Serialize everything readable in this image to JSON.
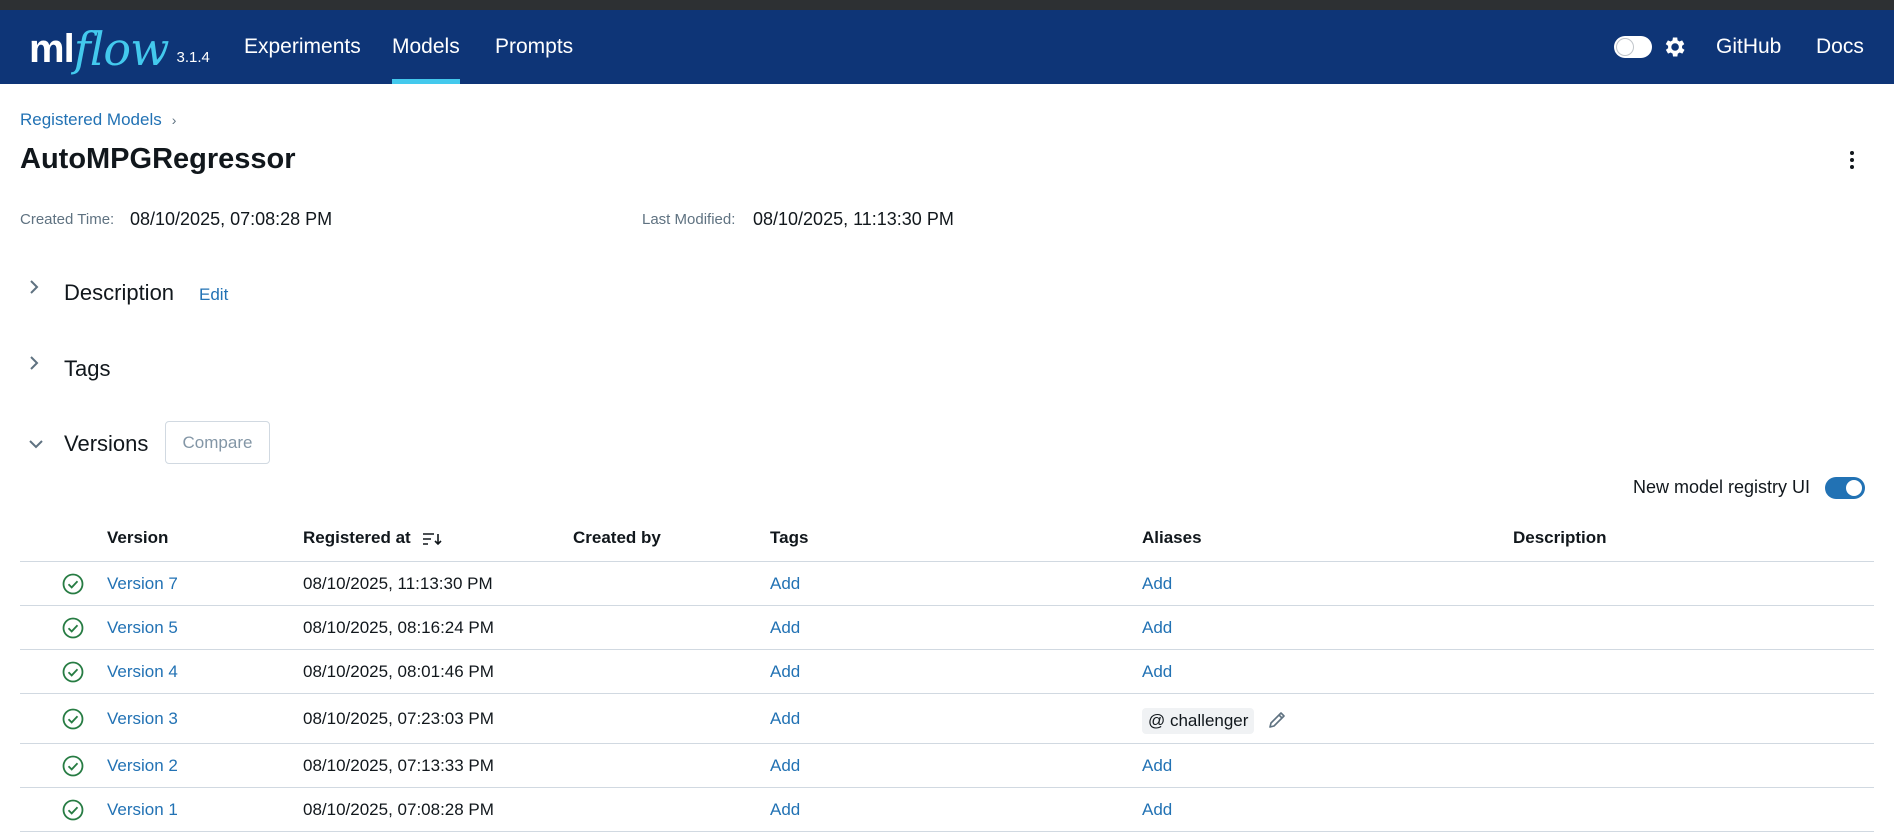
{
  "nav": {
    "logo_ml": "ml",
    "logo_flow": "flow",
    "version": "3.1.4",
    "links": [
      "Experiments",
      "Models",
      "Prompts"
    ],
    "active": "Models",
    "right_links": [
      "GitHub",
      "Docs"
    ]
  },
  "breadcrumb": {
    "parent": "Registered Models"
  },
  "model": {
    "name": "AutoMPGRegressor",
    "created_label": "Created Time:",
    "created_value": "08/10/2025, 07:08:28 PM",
    "modified_label": "Last Modified:",
    "modified_value": "08/10/2025, 11:13:30 PM"
  },
  "sections": {
    "description": "Description",
    "description_edit": "Edit",
    "tags": "Tags",
    "versions": "Versions",
    "compare": "Compare"
  },
  "registry_toggle": {
    "label": "New model registry UI",
    "on": true
  },
  "table": {
    "headers": {
      "version": "Version",
      "registered": "Registered at",
      "created_by": "Created by",
      "tags": "Tags",
      "aliases": "Aliases",
      "description": "Description"
    },
    "rows": [
      {
        "version": "Version 7",
        "registered": "08/10/2025, 11:13:30 PM",
        "tags": "Add",
        "aliases": "Add"
      },
      {
        "version": "Version 5",
        "registered": "08/10/2025, 08:16:24 PM",
        "tags": "Add",
        "aliases": "Add"
      },
      {
        "version": "Version 4",
        "registered": "08/10/2025, 08:01:46 PM",
        "tags": "Add",
        "aliases": "Add"
      },
      {
        "version": "Version 3",
        "registered": "08/10/2025, 07:23:03 PM",
        "tags": "Add",
        "alias_tag": "@ challenger"
      },
      {
        "version": "Version 2",
        "registered": "08/10/2025, 07:13:33 PM",
        "tags": "Add",
        "aliases": "Add"
      },
      {
        "version": "Version 1",
        "registered": "08/10/2025, 07:08:28 PM",
        "tags": "Add",
        "aliases": "Add"
      }
    ]
  },
  "colors": {
    "nav_bg": "#0e3577",
    "accent": "#43c9ed",
    "link": "#2272b4",
    "status_ready": "#277c43"
  }
}
